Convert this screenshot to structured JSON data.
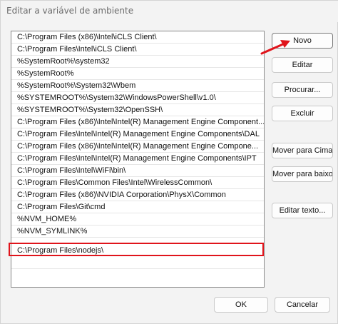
{
  "window": {
    "title": "Editar a variável de ambiente"
  },
  "paths": [
    "C:\\Program Files (x86)\\Intel\\iCLS Client\\",
    "C:\\Program Files\\Intel\\iCLS Client\\",
    "%SystemRoot%\\system32",
    "%SystemRoot%",
    "%SystemRoot%\\System32\\Wbem",
    "%SYSTEMROOT%\\System32\\WindowsPowerShell\\v1.0\\",
    "%SYSTEMROOT%\\System32\\OpenSSH\\",
    "C:\\Program Files (x86)\\Intel\\Intel(R) Management Engine Component...",
    "C:\\Program Files\\Intel\\Intel(R) Management Engine Components\\DAL",
    "C:\\Program Files (x86)\\Intel\\Intel(R) Management Engine Compone...",
    "C:\\Program Files\\Intel\\Intel(R) Management Engine Components\\IPT",
    "C:\\Program Files\\Intel\\WiFi\\bin\\",
    "C:\\Program Files\\Common Files\\Intel\\WirelessCommon\\",
    "C:\\Program Files (x86)\\NVIDIA Corporation\\PhysX\\Common",
    "C:\\Program Files\\Git\\cmd",
    "%NVM_HOME%",
    "%NVM_SYMLINK%",
    "C:\\Program Files\\nodejs\\"
  ],
  "buttons": {
    "novo": "Novo",
    "editar": "Editar",
    "procurar": "Procurar...",
    "excluir": "Excluir",
    "mover_cima": "Mover para Cima",
    "mover_baixo": "Mover para baixo",
    "editar_texto": "Editar texto...",
    "ok": "OK",
    "cancelar": "Cancelar"
  },
  "colors": {
    "highlight": "#e0141b",
    "arrow": "#e0141b"
  }
}
